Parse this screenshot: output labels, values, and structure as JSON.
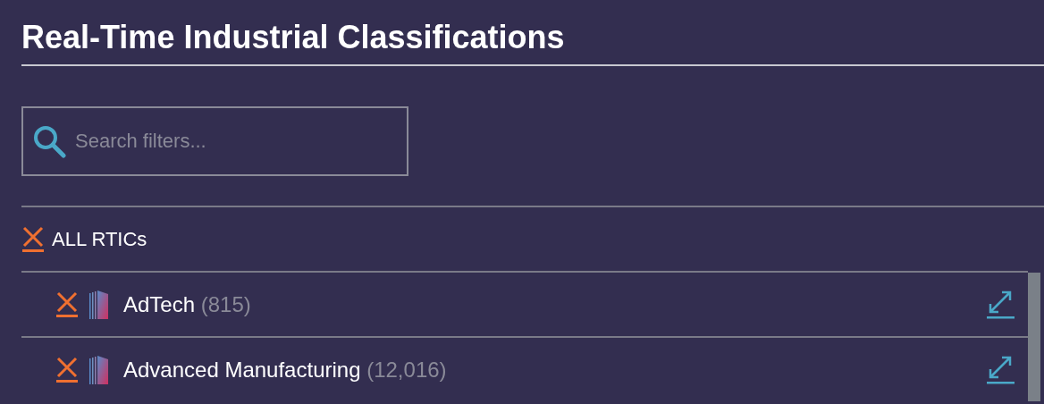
{
  "title": "Real-Time Industrial Classifications",
  "search": {
    "placeholder": "Search filters..."
  },
  "all_filter": {
    "label": "ALL RTICs"
  },
  "items": [
    {
      "name": "AdTech",
      "count": "(815)"
    },
    {
      "name": "Advanced Manufacturing",
      "count": "(12,016)"
    }
  ]
}
